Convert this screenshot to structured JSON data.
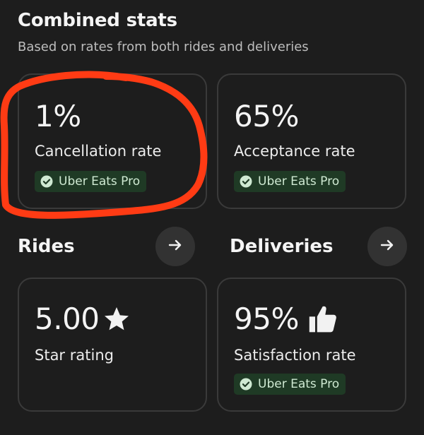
{
  "header": {
    "title": "Combined stats",
    "subtitle": "Based on rates from both rides and deliveries"
  },
  "combined": {
    "cancellation": {
      "value": "1%",
      "label": "Cancellation rate",
      "badge": "Uber Eats Pro"
    },
    "acceptance": {
      "value": "65%",
      "label": "Acceptance rate",
      "badge": "Uber Eats Pro"
    }
  },
  "rides": {
    "title": "Rides",
    "arrow_icon": "arrow-right-icon",
    "star_rating": {
      "value": "5.00",
      "icon": "star-icon",
      "label": "Star rating"
    }
  },
  "deliveries": {
    "title": "Deliveries",
    "arrow_icon": "arrow-right-icon",
    "satisfaction": {
      "value": "95%",
      "icon": "thumbs-up-icon",
      "label": "Satisfaction rate",
      "badge": "Uber Eats Pro"
    }
  },
  "colors": {
    "background": "#1d1d1d",
    "card_border": "#3a3a3a",
    "badge_background": "#1f3a25",
    "badge_check": "#8fd19e",
    "annotation_stroke": "#ff3b14"
  }
}
